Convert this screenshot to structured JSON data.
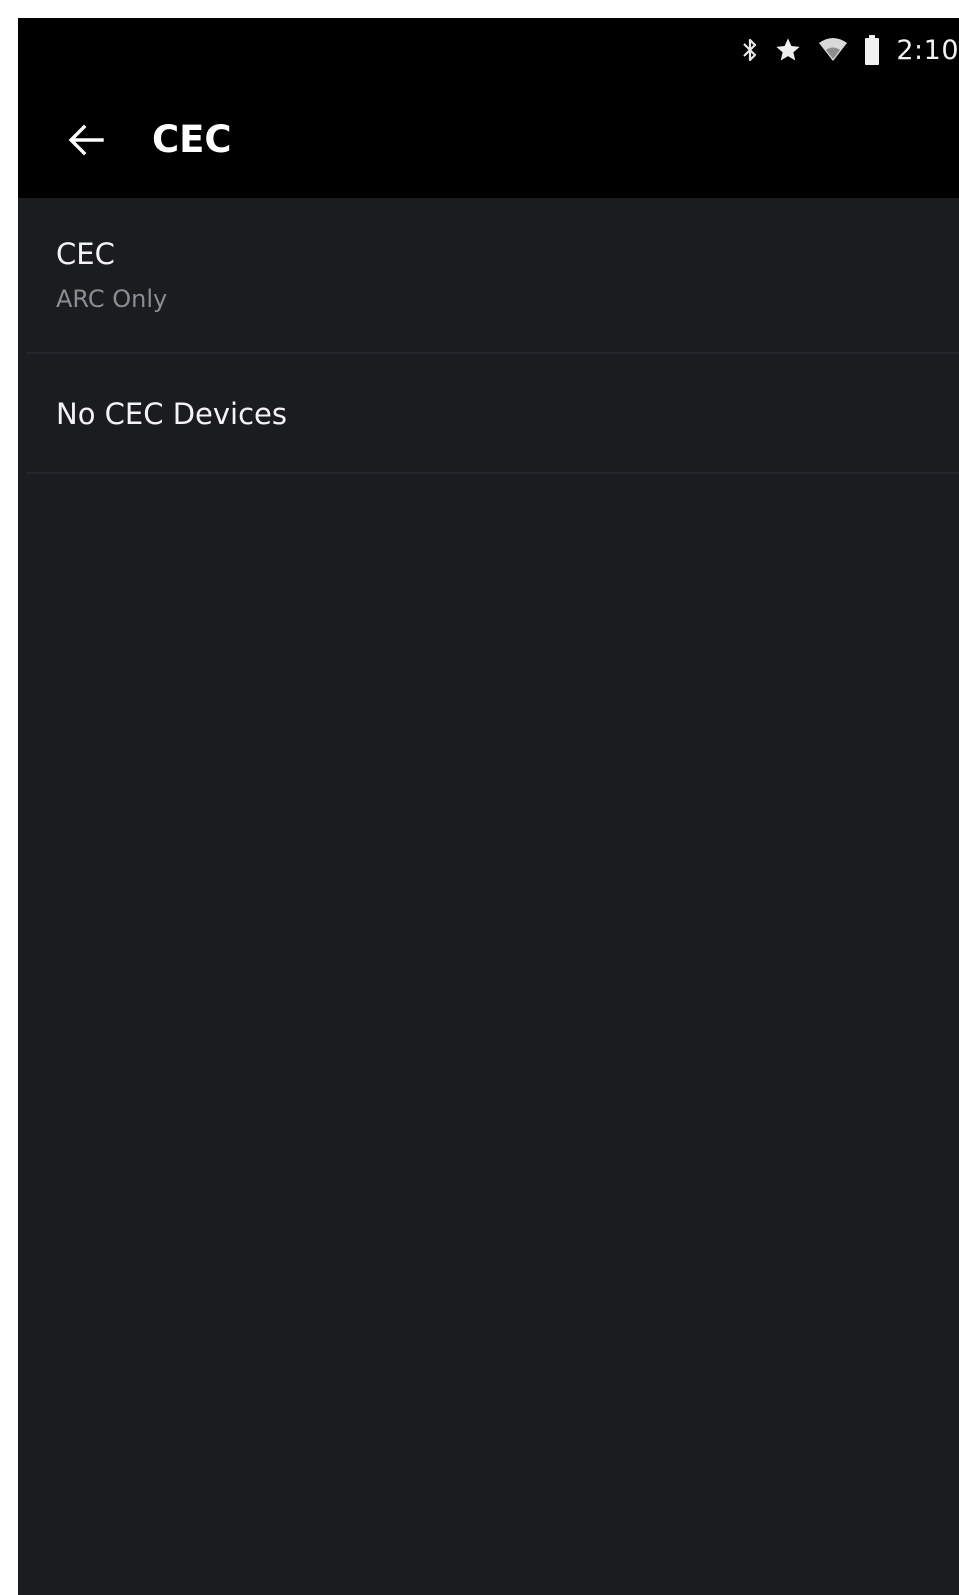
{
  "status_bar": {
    "time": "2:10",
    "icons": [
      "bluetooth-icon",
      "star-icon",
      "wifi-icon",
      "battery-icon"
    ]
  },
  "app_bar": {
    "back_icon": "arrow-back-icon",
    "title": "CEC"
  },
  "list": {
    "items": [
      {
        "title": "CEC",
        "subtitle": "ARC Only"
      },
      {
        "title": "No CEC Devices"
      }
    ]
  },
  "colors": {
    "background": "#1a1c1f",
    "bar": "#000000",
    "primary_text": "#f4f4f4",
    "secondary_text": "#8a8d91"
  }
}
